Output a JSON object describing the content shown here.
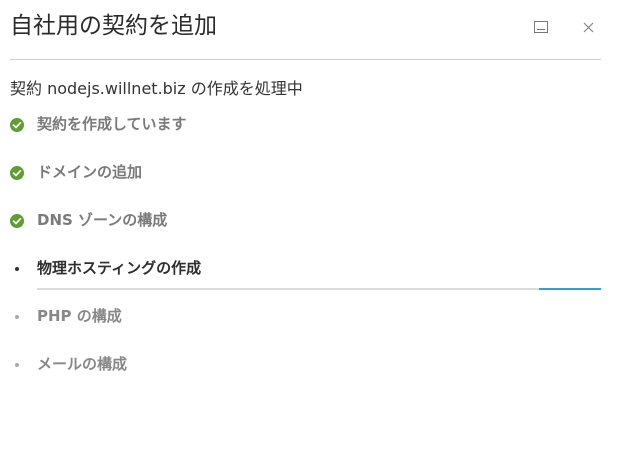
{
  "dialog": {
    "title": "自社用の契約を追加",
    "status_text": "契約 nodejs.willnet.biz の作成を処理中"
  },
  "steps": [
    {
      "label": "契約を作成しています",
      "state": "done",
      "icon": "check-circle-icon"
    },
    {
      "label": "ドメインの追加",
      "state": "done",
      "icon": "check-circle-icon"
    },
    {
      "label": "DNS ゾーンの構成",
      "state": "done",
      "icon": "check-circle-icon"
    },
    {
      "label": "物理ホスティングの作成",
      "state": "active",
      "icon": "bullet-icon",
      "progress": 0.11
    },
    {
      "label": "PHP の構成",
      "state": "pending",
      "icon": "bullet-icon"
    },
    {
      "label": "メールの構成",
      "state": "pending",
      "icon": "bullet-icon"
    }
  ],
  "colors": {
    "success": "#5aa02c",
    "progress": "#2d9fd9",
    "divider": "#cfcfcf"
  }
}
